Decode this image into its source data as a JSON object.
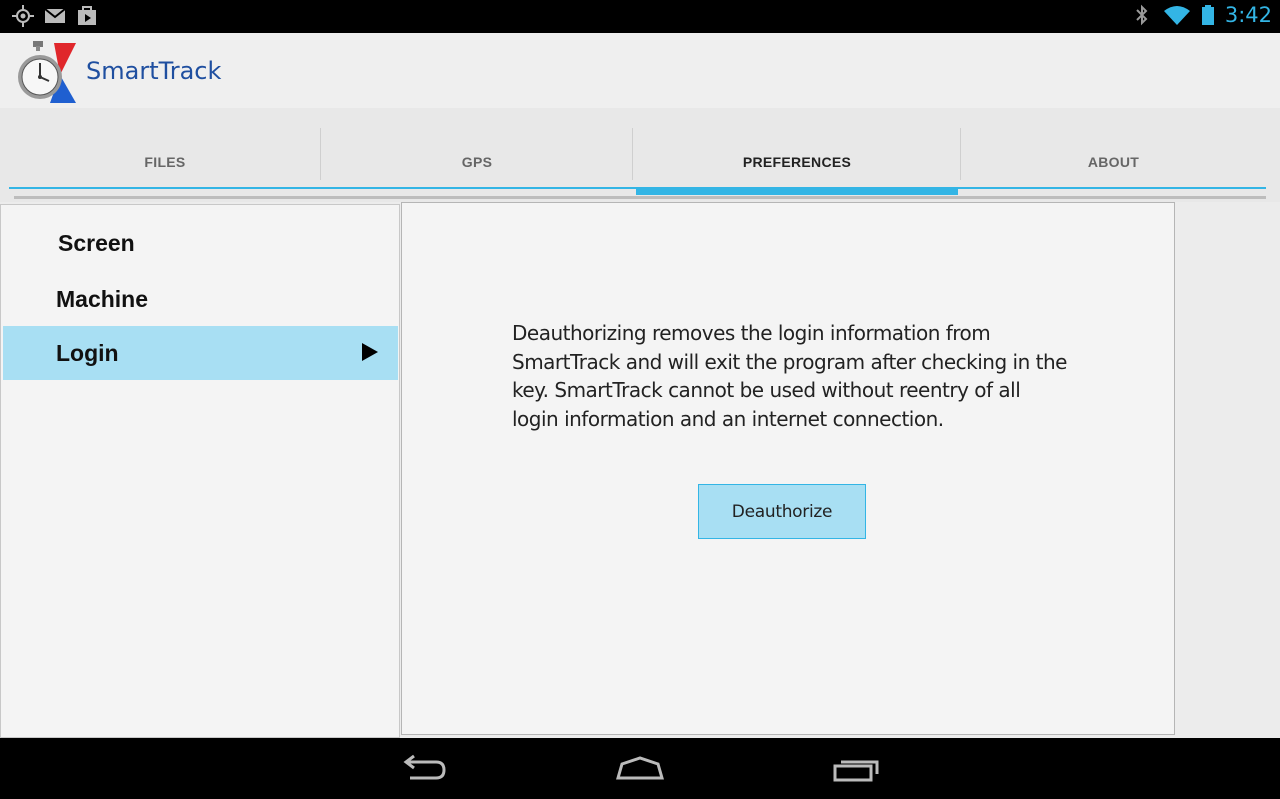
{
  "status_bar": {
    "time": "3:42",
    "left_icons": [
      "gps-icon",
      "gmail-icon",
      "play-store-icon"
    ],
    "right_icons": [
      "bluetooth-icon",
      "wifi-icon",
      "battery-icon"
    ]
  },
  "app": {
    "title": "SmartTrack",
    "logo": "stopwatch-logo"
  },
  "tabs": [
    {
      "label": "FILES",
      "active": false
    },
    {
      "label": "GPS",
      "active": false
    },
    {
      "label": "PREFERENCES",
      "active": true
    },
    {
      "label": "ABOUT",
      "active": false
    }
  ],
  "preferences": {
    "items": [
      {
        "label": "Screen",
        "selected": false
      },
      {
        "label": "Machine",
        "selected": false
      },
      {
        "label": "Login",
        "selected": true
      }
    ]
  },
  "login": {
    "description": "Deauthorizing removes the login information from SmartTrack and will exit the program after checking in the key. SmartTrack cannot be used without reentry of all login information and an internet connection.",
    "button_label": "Deauthorize"
  },
  "colors": {
    "accent": "#33b5e5",
    "selected": "#a8dff3",
    "title": "#1f4fa0"
  },
  "nav_bar": {
    "buttons": [
      "back-icon",
      "home-icon",
      "recents-icon"
    ]
  }
}
